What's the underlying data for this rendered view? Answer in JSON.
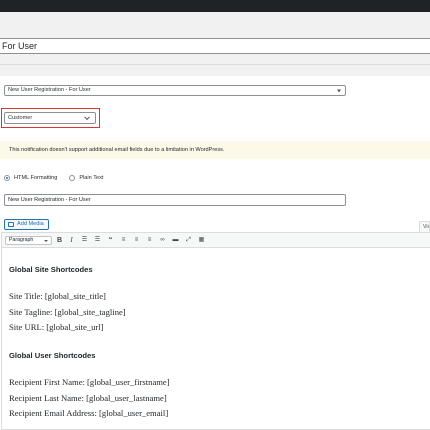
{
  "post_title": "For User",
  "template_select": {
    "value": "New User Registration - For User"
  },
  "recipient_select": {
    "value": "Customer"
  },
  "notice": {
    "text": "This notification doesn't support additional email fields due to a limitation in WordPress."
  },
  "format_options": {
    "html_label": "HTML Formatting",
    "html_checked": true,
    "plain_label": "Plain Text",
    "plain_checked": false
  },
  "subject": {
    "value": "New User Registration - For User"
  },
  "add_media_label": "Add Media",
  "visual_tab_label": "Vis",
  "editor": {
    "format_value": "Paragraph",
    "toolbar_icons": [
      "bold-icon",
      "italic-icon",
      "bulleted-list-icon",
      "numbered-list-icon",
      "blockquote-icon",
      "align-left-icon",
      "align-center-icon",
      "align-right-icon",
      "insert-link-icon",
      "horizontal-line-icon",
      "fullscreen-icon",
      "toolbar-toggle-icon"
    ],
    "content": {
      "site_heading": "Global Site Shortcodes",
      "site_title": "Site Title: [global_site_title]",
      "site_tagline": "Site Tagline: [global_site_tagline]",
      "site_url": "Site URL: [global_site_url]",
      "user_heading": "Global User Shortcodes",
      "first_name": "Recipient First Name: [global_user_firstname]",
      "last_name": "Recipient Last Name: [global_user_lastname]",
      "email": "Recipient Email Address: [global_user_email]"
    }
  },
  "colors": {
    "admin_bar": "#1d2327",
    "highlight_outline": "#d63638",
    "notice_background": "#fcf9e8",
    "link_blue": "#2271b1"
  }
}
